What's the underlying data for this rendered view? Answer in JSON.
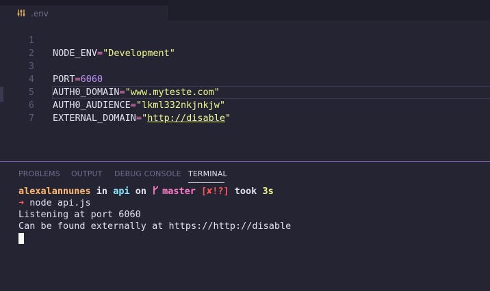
{
  "tab": {
    "filename": ".env",
    "icon": "settings-sliders-icon"
  },
  "editor": {
    "lines": [
      {
        "num": "1",
        "key": "NODE_ENV",
        "eq": "=",
        "value": "\"Development\"",
        "kind": "str"
      },
      {
        "num": "2",
        "key": "",
        "eq": "",
        "value": "",
        "kind": "empty"
      },
      {
        "num": "3",
        "key": "PORT",
        "eq": "=",
        "value": "6060",
        "kind": "num"
      },
      {
        "num": "4",
        "key": "AUTH0_DOMAIN",
        "eq": "=",
        "value": "\"www.myteste.com\"",
        "kind": "str"
      },
      {
        "num": "5",
        "key": "AUTH0_AUDIENCE",
        "eq": "=",
        "value": "\"lkml332nkjnkjw\"",
        "kind": "str"
      },
      {
        "num": "6",
        "key": "EXTERNAL_DOMAIN",
        "eq": "=",
        "value_open": "\"",
        "value_url": "http://disable",
        "value_close": "\"",
        "kind": "url"
      },
      {
        "num": "7",
        "key": "",
        "eq": "",
        "value": "",
        "kind": "empty"
      }
    ]
  },
  "panel": {
    "tabs": [
      "PROBLEMS",
      "OUTPUT",
      "DEBUG CONSOLE",
      "TERMINAL"
    ],
    "active_tab": "TERMINAL"
  },
  "terminal": {
    "prompt": {
      "user": "alexalannunes",
      "in": " in ",
      "dir": "api",
      "on": " on ",
      "branch_icon": "",
      "branch": "master",
      "status": "[✘!?]",
      "took": " took ",
      "time": "3s"
    },
    "arrow": "➜",
    "command": "node api.js",
    "output": [
      "Listening at port 6060",
      "Can be found externally at https://http://disable"
    ]
  },
  "colors": {
    "background": "#252433",
    "panel_border": "#7a61b0",
    "string": "#f1fa8c",
    "number": "#bd93f9",
    "operator": "#ff79c6"
  }
}
